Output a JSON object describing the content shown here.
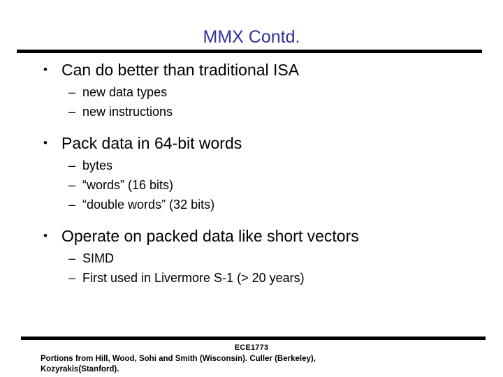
{
  "slide": {
    "title": "MMX Contd.",
    "title_color": "#333399",
    "text_color": "#000000",
    "background_color": "#ffffff",
    "rule_color": "#000000",
    "bullet_marker": "•",
    "dash_marker": "–",
    "groups": [
      {
        "heading": "Can do better than traditional ISA",
        "subitems": [
          "new data types",
          "new instructions"
        ]
      },
      {
        "heading": "Pack data in 64-bit words",
        "subitems": [
          "bytes",
          "“words” (16 bits)",
          "“double words” (32 bits)"
        ]
      },
      {
        "heading": "Operate on packed data like short vectors",
        "subitems": [
          "SIMD",
          "First used in Livermore S-1 (> 20 years)"
        ]
      }
    ]
  },
  "footer": {
    "course": "ECE1773",
    "credit_line_1": "Portions from Hill, Wood, Sohi and Smith (Wisconsin). Culler (Berkeley),",
    "credit_line_2": "Kozyrakis(Stanford)."
  }
}
